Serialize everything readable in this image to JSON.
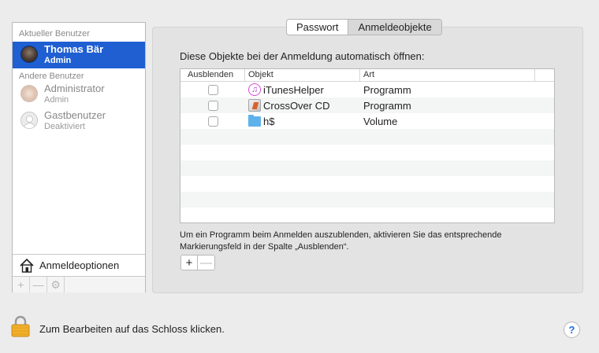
{
  "sidebar": {
    "current_header": "Aktueller Benutzer",
    "other_header": "Andere Benutzer",
    "current_user": {
      "name": "Thomas Bär",
      "role": "Admin"
    },
    "other_users": [
      {
        "name": "Administrator",
        "role": "Admin"
      },
      {
        "name": "Gastbenutzer",
        "role": "Deaktiviert"
      }
    ],
    "login_options_label": "Anmeldeoptionen",
    "toolbar": {
      "add": "+",
      "remove": "—",
      "settings": "⚙"
    }
  },
  "tabs": [
    {
      "label": "Passwort",
      "active": false
    },
    {
      "label": "Anmeldeobjekte",
      "active": true
    }
  ],
  "intro_text": "Diese Objekte bei der Anmeldung automatisch öffnen:",
  "table": {
    "columns": [
      "Ausblenden",
      "Objekt",
      "Art"
    ],
    "rows": [
      {
        "hide": false,
        "icon": "itunes-helper-icon",
        "object": "iTunesHelper",
        "kind": "Programm"
      },
      {
        "hide": false,
        "icon": "crossover-icon",
        "object": "CrossOver CD",
        "kind": "Programm"
      },
      {
        "hide": false,
        "icon": "folder-icon",
        "object": "h$",
        "kind": "Volume"
      }
    ]
  },
  "hint_text": "Um ein Programm beim Anmelden auszublenden, aktivieren Sie das entsprechende Markierungsfeld in der Spalte „Ausblenden“.",
  "add_remove": {
    "add": "+",
    "remove": "—"
  },
  "lock_text": "Zum Bearbeiten auf das Schloss klicken.",
  "help_label": "?",
  "colors": {
    "selection": "#1f5fd2",
    "accent": "#1f6fd6",
    "lock": "#f0b02b"
  }
}
